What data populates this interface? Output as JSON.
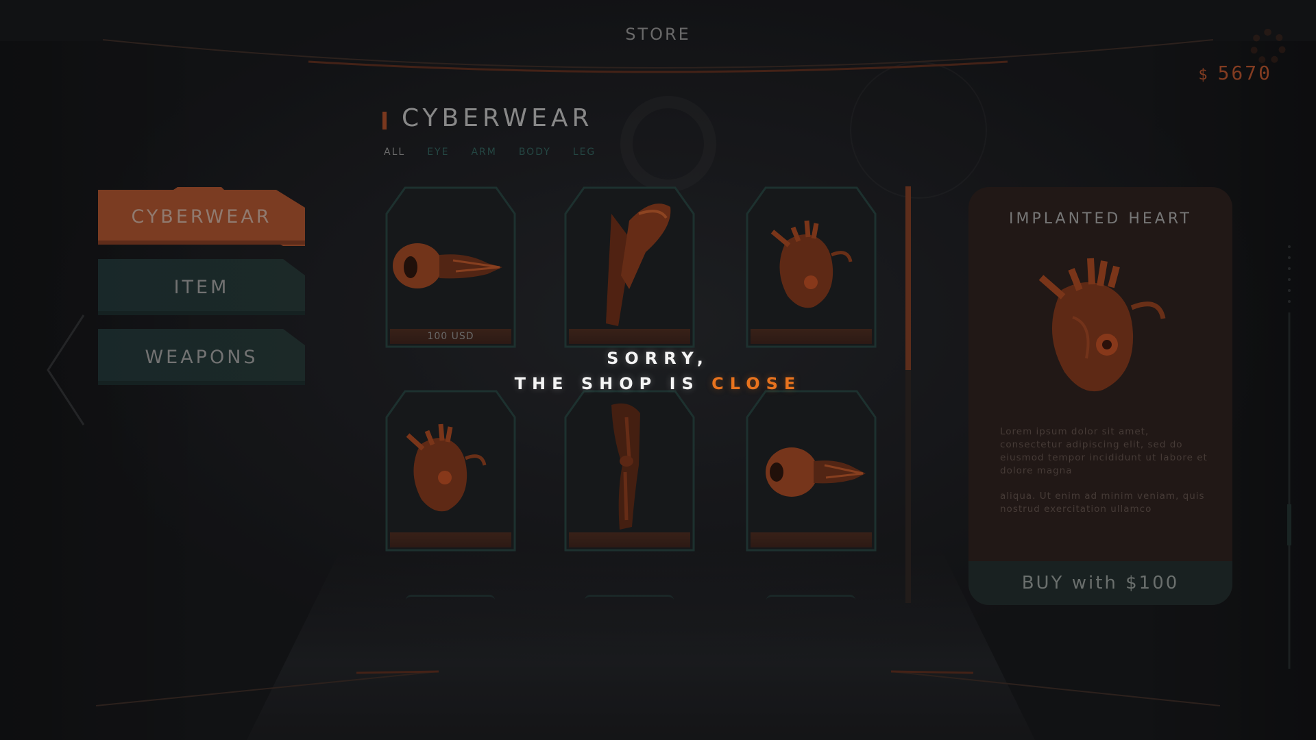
{
  "header": {
    "title": "STORE"
  },
  "wallet": {
    "symbol": "$",
    "amount": "5670"
  },
  "category": {
    "title": "CYBERWEAR",
    "filters": [
      {
        "label": "ALL",
        "active": true
      },
      {
        "label": "EYE",
        "active": false
      },
      {
        "label": "ARM",
        "active": false
      },
      {
        "label": "BODY",
        "active": false
      },
      {
        "label": "LEG",
        "active": false
      }
    ]
  },
  "nav": {
    "items": [
      {
        "label": "CYBERWEAR",
        "active": true
      },
      {
        "label": "ITEM",
        "active": false
      },
      {
        "label": "WEAPONS",
        "active": false
      }
    ]
  },
  "products": [
    {
      "icon": "eye-implant-icon",
      "price": "100 USD"
    },
    {
      "icon": "arm-implant-icon",
      "price": ""
    },
    {
      "icon": "heart-implant-icon",
      "price": ""
    },
    {
      "icon": "heart-implant-icon",
      "price": ""
    },
    {
      "icon": "leg-implant-icon",
      "price": ""
    },
    {
      "icon": "eye-implant-icon",
      "price": ""
    }
  ],
  "detail": {
    "title": "IMPLANTED HEART",
    "icon": "heart-implant-icon",
    "description": [
      "Lorem ipsum dolor sit amet, consectetur adipiscing elit, sed do eiusmod tempor incididunt ut labore et dolore magna",
      "aliqua. Ut enim ad minim veniam, quis nostrud exercitation ullamco"
    ],
    "buy_label": "BUY with $100"
  },
  "overlay": {
    "line1": "SORRY,",
    "line2_prefix": "THE SHOP IS ",
    "line2_accent": "CLOSE"
  },
  "colors": {
    "accent": "#b2502a",
    "accent_bright": "#e8731e",
    "teal": "#2f5e59",
    "background": "#151619"
  }
}
